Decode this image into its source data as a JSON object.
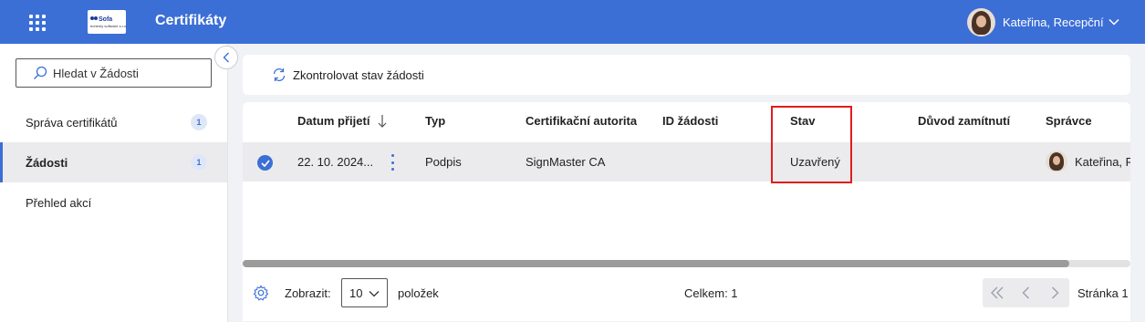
{
  "header": {
    "title": "Certifikáty",
    "logo_line1": "Sofa",
    "logo_line2": "bohemy software s.r.o.",
    "user_name": "Kateřina, Recepční"
  },
  "sidebar": {
    "search_placeholder": "Hledat v Žádosti",
    "items": [
      {
        "label": "Správa certifikátů",
        "badge": "1"
      },
      {
        "label": "Žádosti",
        "badge": "1"
      },
      {
        "label": "Přehled akcí"
      }
    ]
  },
  "toolbar": {
    "check_status_label": "Zkontrolovat stav žádosti"
  },
  "table": {
    "columns": [
      "Datum přijetí",
      "Typ",
      "Certifikační autorita",
      "ID žádosti",
      "Stav",
      "Důvod zamítnutí",
      "Správce"
    ],
    "rows": [
      {
        "date": "22. 10. 2024...",
        "type": "Podpis",
        "authority": "SignMaster CA",
        "request_id": "",
        "status": "Uzavřený",
        "reason": "",
        "admin": "Kateřina, R"
      }
    ]
  },
  "footer": {
    "show_label": "Zobrazit:",
    "page_size": "10",
    "items_label": "položek",
    "total_label": "Celkem: 1",
    "page_label": "Stránka 1"
  },
  "colors": {
    "brand": "#3b6fd6",
    "highlight": "#e11d1d"
  }
}
